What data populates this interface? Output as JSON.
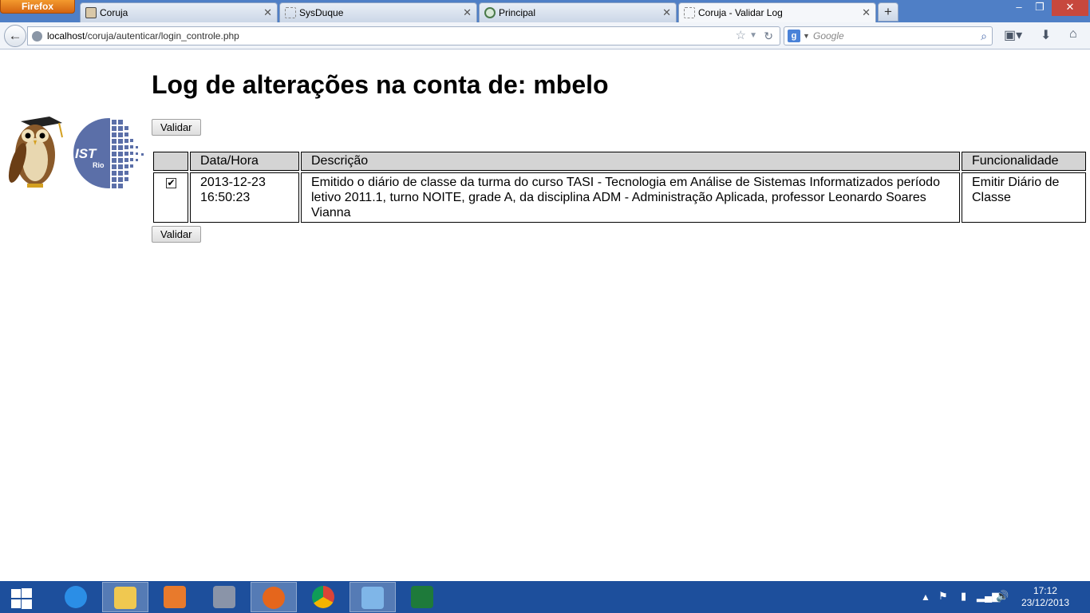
{
  "browser": {
    "menu_button": "Firefox",
    "tabs": [
      {
        "label": "Coruja",
        "icon": "owl-icon"
      },
      {
        "label": "SysDuque",
        "icon": "blank-page-icon"
      },
      {
        "label": "Principal",
        "icon": "globe-icon"
      },
      {
        "label": "Coruja - Validar Log",
        "icon": "blank-page-icon"
      }
    ],
    "url_host": "localhost",
    "url_path": "/coruja/autenticar/login_controle.php",
    "search_placeholder": "Google"
  },
  "page": {
    "title": "Log de alterações na conta de: mbelo",
    "validate_button": "Validar",
    "table": {
      "headers": [
        "",
        "Data/Hora",
        "Descrição",
        "Funcionalidade"
      ],
      "rows": [
        {
          "checked": true,
          "datetime": "2013-12-23 16:50:23",
          "description": "Emitido o diário de classe da turma do curso TASI - Tecnologia em Análise de Sistemas Informatizados período letivo 2011.1, turno NOITE, grade A, da disciplina ADM - Administração Aplicada, professor Leonardo Soares Vianna",
          "functionality": "Emitir Diário de Classe"
        }
      ]
    },
    "logo_text": "IST Rio"
  },
  "taskbar": {
    "time": "17:12",
    "date": "23/12/2013"
  },
  "colors": {
    "titlebar": "#4f7fc6",
    "taskbar": "#1d4f9c",
    "header_bg": "#d4d4d4",
    "ist_logo": "#5b6fa8"
  }
}
